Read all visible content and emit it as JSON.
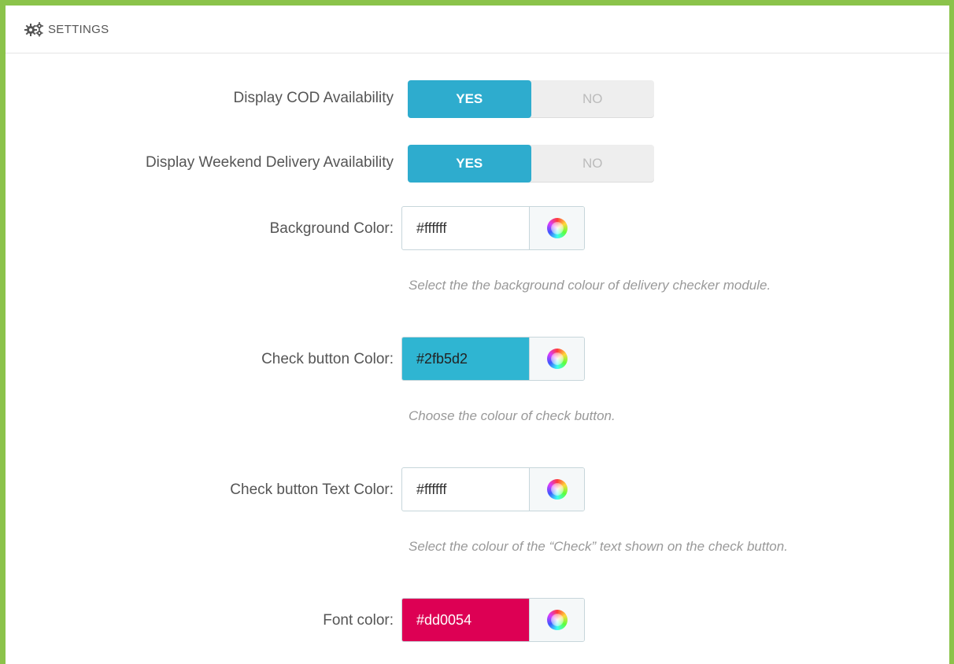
{
  "panel": {
    "title": "SETTINGS",
    "icon": "cogs-icon"
  },
  "cod": {
    "label": "Display COD Availability",
    "yes": "YES",
    "no": "NO",
    "value": "YES"
  },
  "weekend": {
    "label": "Display Weekend Delivery Availability",
    "yes": "YES",
    "no": "NO",
    "value": "YES"
  },
  "background_color": {
    "label": "Background Color:",
    "value": "#ffffff",
    "help": "Select the the background colour of delivery checker module."
  },
  "check_button_color": {
    "label": "Check button Color:",
    "value": "#2fb5d2",
    "help": "Choose the colour of check button."
  },
  "check_button_text_color": {
    "label": "Check button Text Color:",
    "value": "#ffffff",
    "help": "Select the colour of the “Check” text shown on the check button."
  },
  "font_color": {
    "label": "Font color:",
    "value": "#dd0054"
  },
  "colors": {
    "frame_border": "#8bc34a",
    "switch_active": "#2eacce",
    "check_button_swatch": "#2fb5d2",
    "font_swatch": "#dd0054"
  }
}
